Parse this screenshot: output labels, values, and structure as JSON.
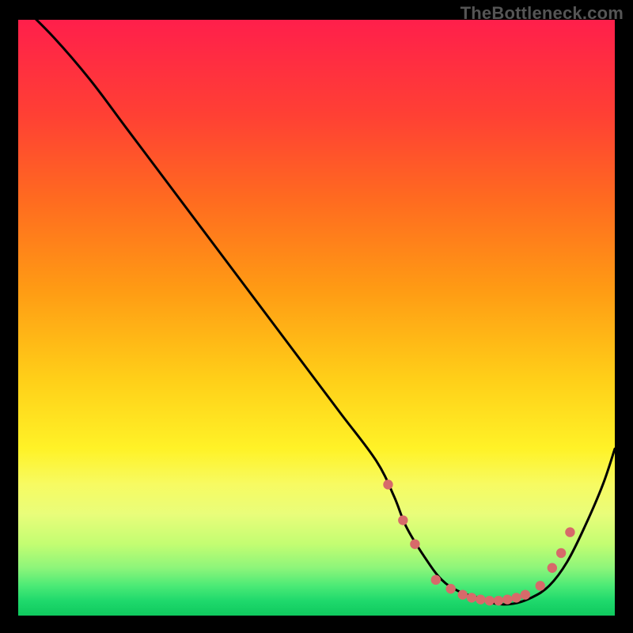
{
  "attribution": "TheBottleneck.com",
  "gradient": {
    "stops": [
      {
        "offset": 0.0,
        "color": "#ff1f4b"
      },
      {
        "offset": 0.16,
        "color": "#ff4034"
      },
      {
        "offset": 0.3,
        "color": "#ff6a20"
      },
      {
        "offset": 0.45,
        "color": "#ff9a14"
      },
      {
        "offset": 0.6,
        "color": "#ffce18"
      },
      {
        "offset": 0.72,
        "color": "#fff227"
      },
      {
        "offset": 0.78,
        "color": "#f7fb62"
      },
      {
        "offset": 0.83,
        "color": "#e9fd7a"
      },
      {
        "offset": 0.88,
        "color": "#c3fd72"
      },
      {
        "offset": 0.92,
        "color": "#8df57a"
      },
      {
        "offset": 0.95,
        "color": "#4bea76"
      },
      {
        "offset": 0.975,
        "color": "#1fd96c"
      },
      {
        "offset": 1.0,
        "color": "#0fc95e"
      }
    ]
  },
  "chart_data": {
    "type": "line",
    "title": "",
    "xlabel": "",
    "ylabel": "",
    "xlim": [
      0,
      100
    ],
    "ylim": [
      0,
      100
    ],
    "series": [
      {
        "name": "bottleneck-curve",
        "x": [
          0,
          6,
          12,
          18,
          24,
          30,
          36,
          42,
          48,
          54,
          60,
          63,
          65,
          68,
          71,
          74,
          77,
          80,
          83,
          86,
          89,
          92,
          95,
          98,
          100
        ],
        "y": [
          103,
          97,
          90,
          82,
          74,
          66,
          58,
          50,
          42,
          34,
          26,
          20,
          15,
          10,
          6,
          4,
          3,
          2,
          2,
          3,
          5,
          9,
          15,
          22,
          28
        ]
      }
    ],
    "markers": {
      "name": "highlight-dots",
      "color": "#d76a6a",
      "x": [
        62,
        64.5,
        66.5,
        70,
        72.5,
        74.5,
        76,
        77.5,
        79,
        80.5,
        82,
        83.5,
        85,
        87.5,
        89.5,
        91,
        92.5
      ],
      "y": [
        22,
        16,
        12,
        6,
        4.5,
        3.5,
        3,
        2.7,
        2.5,
        2.5,
        2.7,
        3,
        3.5,
        5,
        8,
        10.5,
        14
      ]
    }
  }
}
